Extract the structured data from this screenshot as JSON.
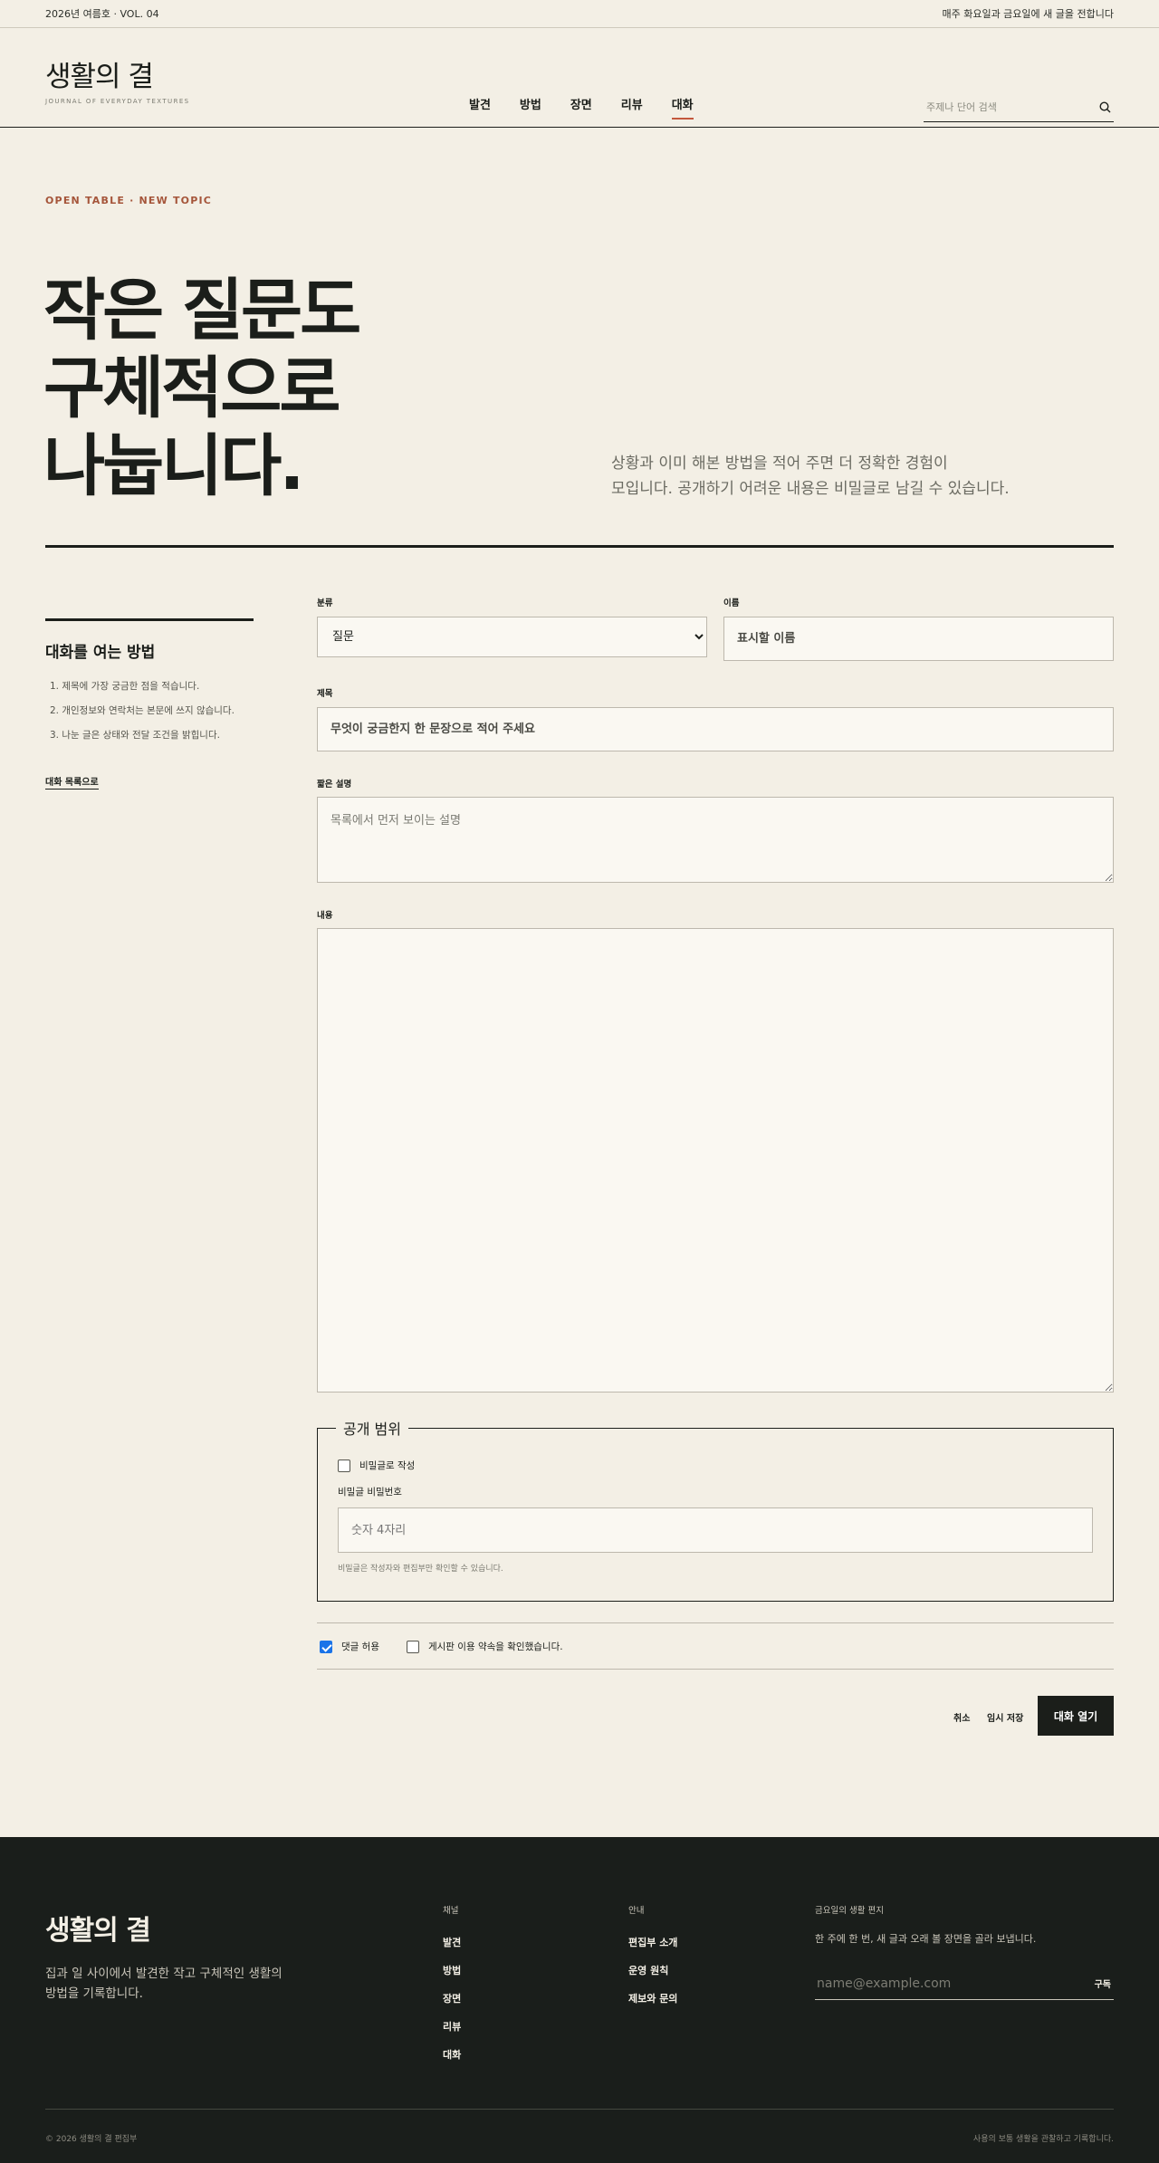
{
  "topbar": {
    "issue": "2026년 여름호 · VOL. 04",
    "notice": "매주 화요일과 금요일에 새 글을 전합니다"
  },
  "header": {
    "logo_title": "생활의 결",
    "logo_sub": "JOURNAL OF EVERYDAY TEXTURES",
    "nav": [
      "발견",
      "방법",
      "장면",
      "리뷰",
      "대화"
    ],
    "active_nav": "대화",
    "search_placeholder": "주제나 단어 검색",
    "search_icon": "search-icon"
  },
  "hero": {
    "eyebrow": "OPEN TABLE · NEW TOPIC",
    "title_lines": [
      "작은 질문도",
      "구체적으로",
      "나눕니다."
    ],
    "description_lines": [
      "상황과 이미 해본 방법을 적어 주면 더 정확한 경험이",
      "모입니다. 공개하기 어려운 내용은 비밀글로 남길 수 있습니다."
    ]
  },
  "side": {
    "title": "대화를 여는 방법",
    "steps": [
      "1. 제목에 가장 궁금한 점을 적습니다.",
      "2. 개인정보와 연락처는 본문에 쓰지 않습니다.",
      "3. 나눈 글은 상태와 전달 조건을 밝힙니다."
    ],
    "back_link": "대화 목록으로"
  },
  "form": {
    "category_label": "분류",
    "category_value": "질문",
    "name_label": "이름",
    "name_placeholder": "표시할 이름",
    "title_label": "제목",
    "title_placeholder": "무엇이 궁금한지 한 문장으로 적어 주세요",
    "summary_label": "짧은 설명",
    "summary_placeholder": "목록에서 먼저 보이는 설명",
    "body_label": "내용",
    "body_value": "",
    "scope": {
      "legend": "공개 범위",
      "secret_label": "비밀글로 작성",
      "secret_checked": false,
      "password_label": "비밀글 비밀번호",
      "password_placeholder": "숫자 4자리",
      "password_hint": "비밀글은 작성자와 편집부만 확인할 수 있습니다."
    },
    "allow_comments_label": "댓글 허용",
    "allow_comments_checked": true,
    "agree_label": "게시판 이용 약속을 확인했습니다.",
    "agree_checked": false,
    "cancel_label": "취소",
    "draft_label": "임시 저장",
    "submit_label": "대화 열기"
  },
  "footer": {
    "logo": "생활의 결",
    "description_lines": [
      "집과 일 사이에서 발견한 작고 구체적인 생활의",
      "방법을 기록합니다."
    ],
    "channel_head": "채널",
    "channels": [
      "발견",
      "방법",
      "장면",
      "리뷰",
      "대화"
    ],
    "guide_head": "안내",
    "guides": [
      "편집부 소개",
      "운영 원칙",
      "제보와 문의"
    ],
    "letter_head": "금요일의 생활 편지",
    "letter_desc": "한 주에 한 번, 새 글과 오래 볼 장면을 골라 보냅니다.",
    "email_placeholder": "name@example.com",
    "subscribe_label": "구독",
    "copyright": "© 2026 생활의 결 편집부",
    "tagline": "사용의 보통 생활을 관찰하고 기록합니다."
  },
  "colors": {
    "background": "#f3efe5",
    "ink": "#1b1e1a",
    "accent": "#c4583d",
    "eyebrow": "#a5553a",
    "footer_bg": "#1a1e1b",
    "checkbox_on": "#1a73e8"
  }
}
